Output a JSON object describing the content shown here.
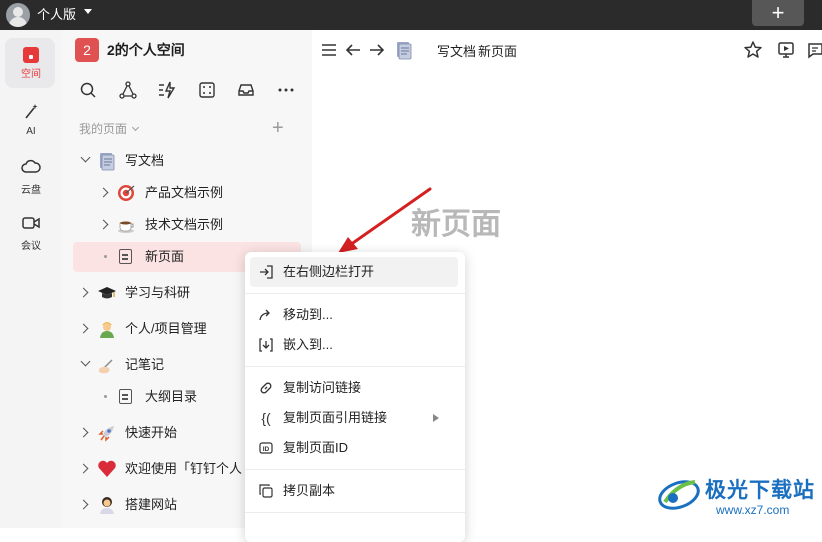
{
  "topbar": {
    "edition": "个人版",
    "new_button": "+"
  },
  "rail": {
    "items": [
      {
        "label": "空间",
        "icon": "space-icon"
      },
      {
        "label": "AI",
        "icon": "magic-wand-icon"
      },
      {
        "label": "云盘",
        "icon": "cloud-icon"
      },
      {
        "label": "会议",
        "icon": "video-icon"
      }
    ]
  },
  "sidebar": {
    "space_badge": "2",
    "space_title": "2的个人空间",
    "tools": [
      "search-icon",
      "graph-icon",
      "flash-icon",
      "scan-icon",
      "inbox-icon",
      "more-icon"
    ],
    "section_label": "我的页面",
    "tree": [
      {
        "label": "写文档",
        "icon": "doc-stack-icon",
        "level": 0,
        "expanded": true
      },
      {
        "label": "产品文档示例",
        "icon": "target-icon",
        "level": 1
      },
      {
        "label": "技术文档示例",
        "icon": "coffee-icon",
        "level": 1
      },
      {
        "label": "新页面",
        "icon": "page-icon",
        "level": 1,
        "selected": true
      },
      {
        "label": "学习与科研",
        "icon": "graduation-cap-icon",
        "level": 0
      },
      {
        "label": "个人/项目管理",
        "icon": "person-icon",
        "level": 0
      },
      {
        "label": "记笔记",
        "icon": "writing-hand-icon",
        "level": 0,
        "expanded": true
      },
      {
        "label": "大纲目录",
        "icon": "page-icon",
        "level": 1
      },
      {
        "label": "快速开始",
        "icon": "rocket-icon",
        "level": 0
      },
      {
        "label": "欢迎使用「钉钉个人",
        "icon": "heart-icon",
        "level": 0
      },
      {
        "label": "搭建网站",
        "icon": "woman-icon",
        "level": 0
      }
    ]
  },
  "header": {
    "breadcrumb": [
      "写文档",
      "新页面"
    ],
    "separator": ">"
  },
  "page": {
    "heading": "新页面"
  },
  "context_menu": {
    "items": [
      {
        "label": "在右侧边栏打开",
        "icon": "open-sidebar-icon"
      },
      {
        "label": "移动到...",
        "icon": "move-arrow-icon"
      },
      {
        "label": "嵌入到...",
        "icon": "embed-icon"
      },
      {
        "label": "复制访问链接",
        "icon": "link-icon"
      },
      {
        "label": "复制页面引用链接",
        "icon": "brace-icon",
        "has_submenu": true
      },
      {
        "label": "复制页面ID",
        "icon": "id-icon"
      },
      {
        "label": "拷贝副本",
        "icon": "copy-icon"
      }
    ]
  },
  "watermark": {
    "name": "极光下载站",
    "url": "www.xz7.com"
  },
  "colors": {
    "accent": "#e63a3a",
    "selected_bg": "#fbe3e3",
    "annotation_arrow": "#d42020"
  }
}
